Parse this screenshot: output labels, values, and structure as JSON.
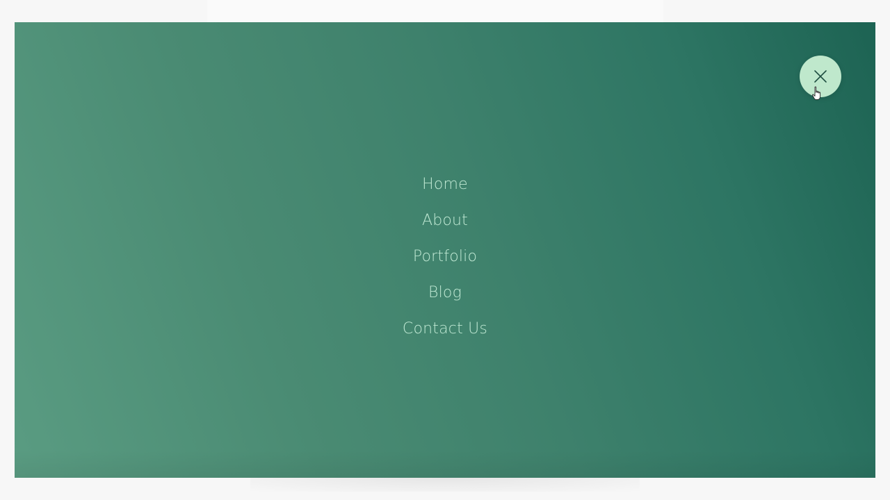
{
  "menu": {
    "items": [
      {
        "id": "home",
        "label": "Home"
      },
      {
        "id": "about",
        "label": "About"
      },
      {
        "id": "portfolio",
        "label": "Portfolio"
      },
      {
        "id": "blog",
        "label": "Blog"
      },
      {
        "id": "contact-us",
        "label": "Contact Us"
      }
    ],
    "close_icon": "close-icon",
    "cursor_icon": "hand-pointer-icon"
  },
  "colors": {
    "gradient_light": "#5a9c82",
    "gradient_dark": "#1d6353",
    "close_button_bg": "#bfe8cc",
    "link_color": "#bfe8d3",
    "page_bg": "#f7f7f7"
  }
}
